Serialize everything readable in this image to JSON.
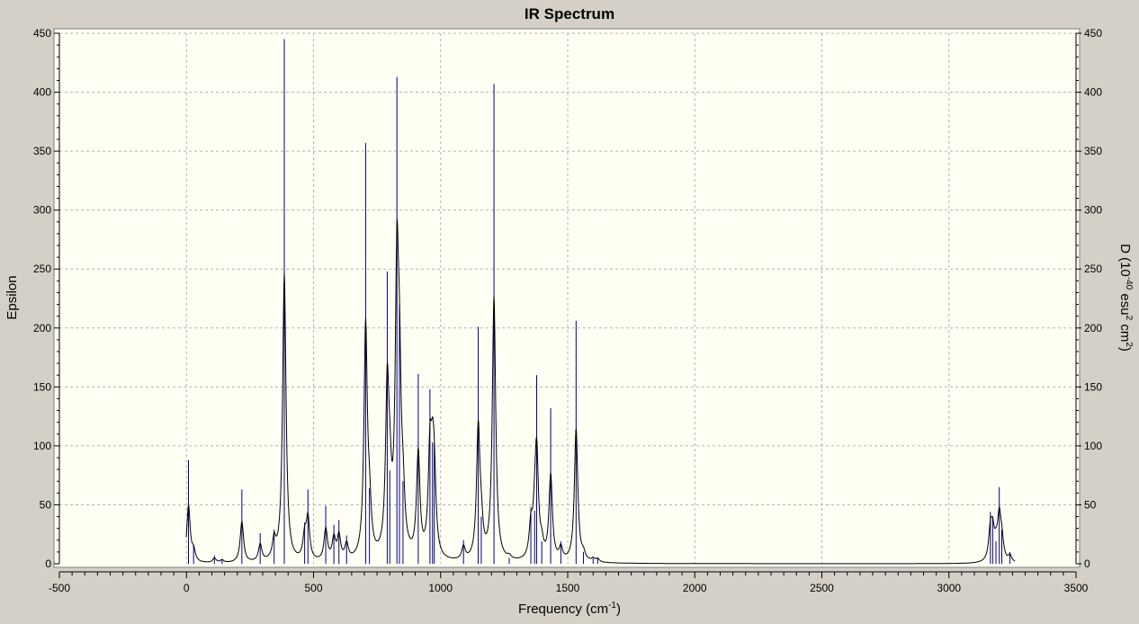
{
  "chart_data": {
    "type": "line",
    "title": "IR Spectrum",
    "xlabel": "Frequency (cm",
    "xlabel_sup": "-1",
    "xlabel_tail": ")",
    "ylabel": "Epsilon",
    "y2label_parts": [
      {
        "t": "D (10",
        "sup": false
      },
      {
        "t": "-40",
        "sup": true
      },
      {
        "t": " esu",
        "sup": false
      },
      {
        "t": "2",
        "sup": true
      },
      {
        "t": " cm",
        "sup": false
      },
      {
        "t": "2",
        "sup": true
      },
      {
        "t": ")",
        "sup": false
      }
    ],
    "xlim": [
      -500,
      3500
    ],
    "ylim": [
      0,
      450
    ],
    "x_ticks": [
      -500,
      0,
      500,
      1000,
      1500,
      2000,
      2500,
      3000,
      3500
    ],
    "y_ticks": [
      0,
      50,
      100,
      150,
      200,
      250,
      300,
      350,
      400,
      450
    ],
    "grid": true,
    "colors": {
      "background": "#fffff4",
      "frame": "#d4d0c8",
      "spectrum": "#000000",
      "sticks": "#000080",
      "grid": "#b4b4b4"
    },
    "stick_spectrum": {
      "name": "",
      "x": [
        8,
        28,
        110,
        140,
        218,
        290,
        345,
        385,
        465,
        478,
        548,
        580,
        600,
        630,
        705,
        720,
        790,
        800,
        828,
        838,
        852,
        912,
        958,
        968,
        975,
        1090,
        1148,
        1160,
        1210,
        1270,
        1355,
        1370,
        1378,
        1398,
        1433,
        1473,
        1533,
        1562,
        1600,
        1618,
        3163,
        3172,
        3185,
        3198,
        3208,
        3240
      ],
      "y": [
        88,
        16,
        7,
        4,
        63,
        26,
        29,
        445,
        35,
        63,
        49,
        33,
        37,
        24,
        357,
        64,
        248,
        79,
        413,
        220,
        70,
        161,
        148,
        103,
        102,
        20,
        201,
        40,
        407,
        5,
        48,
        45,
        160,
        19,
        132,
        19,
        206,
        10,
        5,
        5,
        44,
        40,
        19,
        65,
        29,
        10
      ]
    },
    "spectrum_width": 8,
    "spectrum_scale": 0.55
  }
}
